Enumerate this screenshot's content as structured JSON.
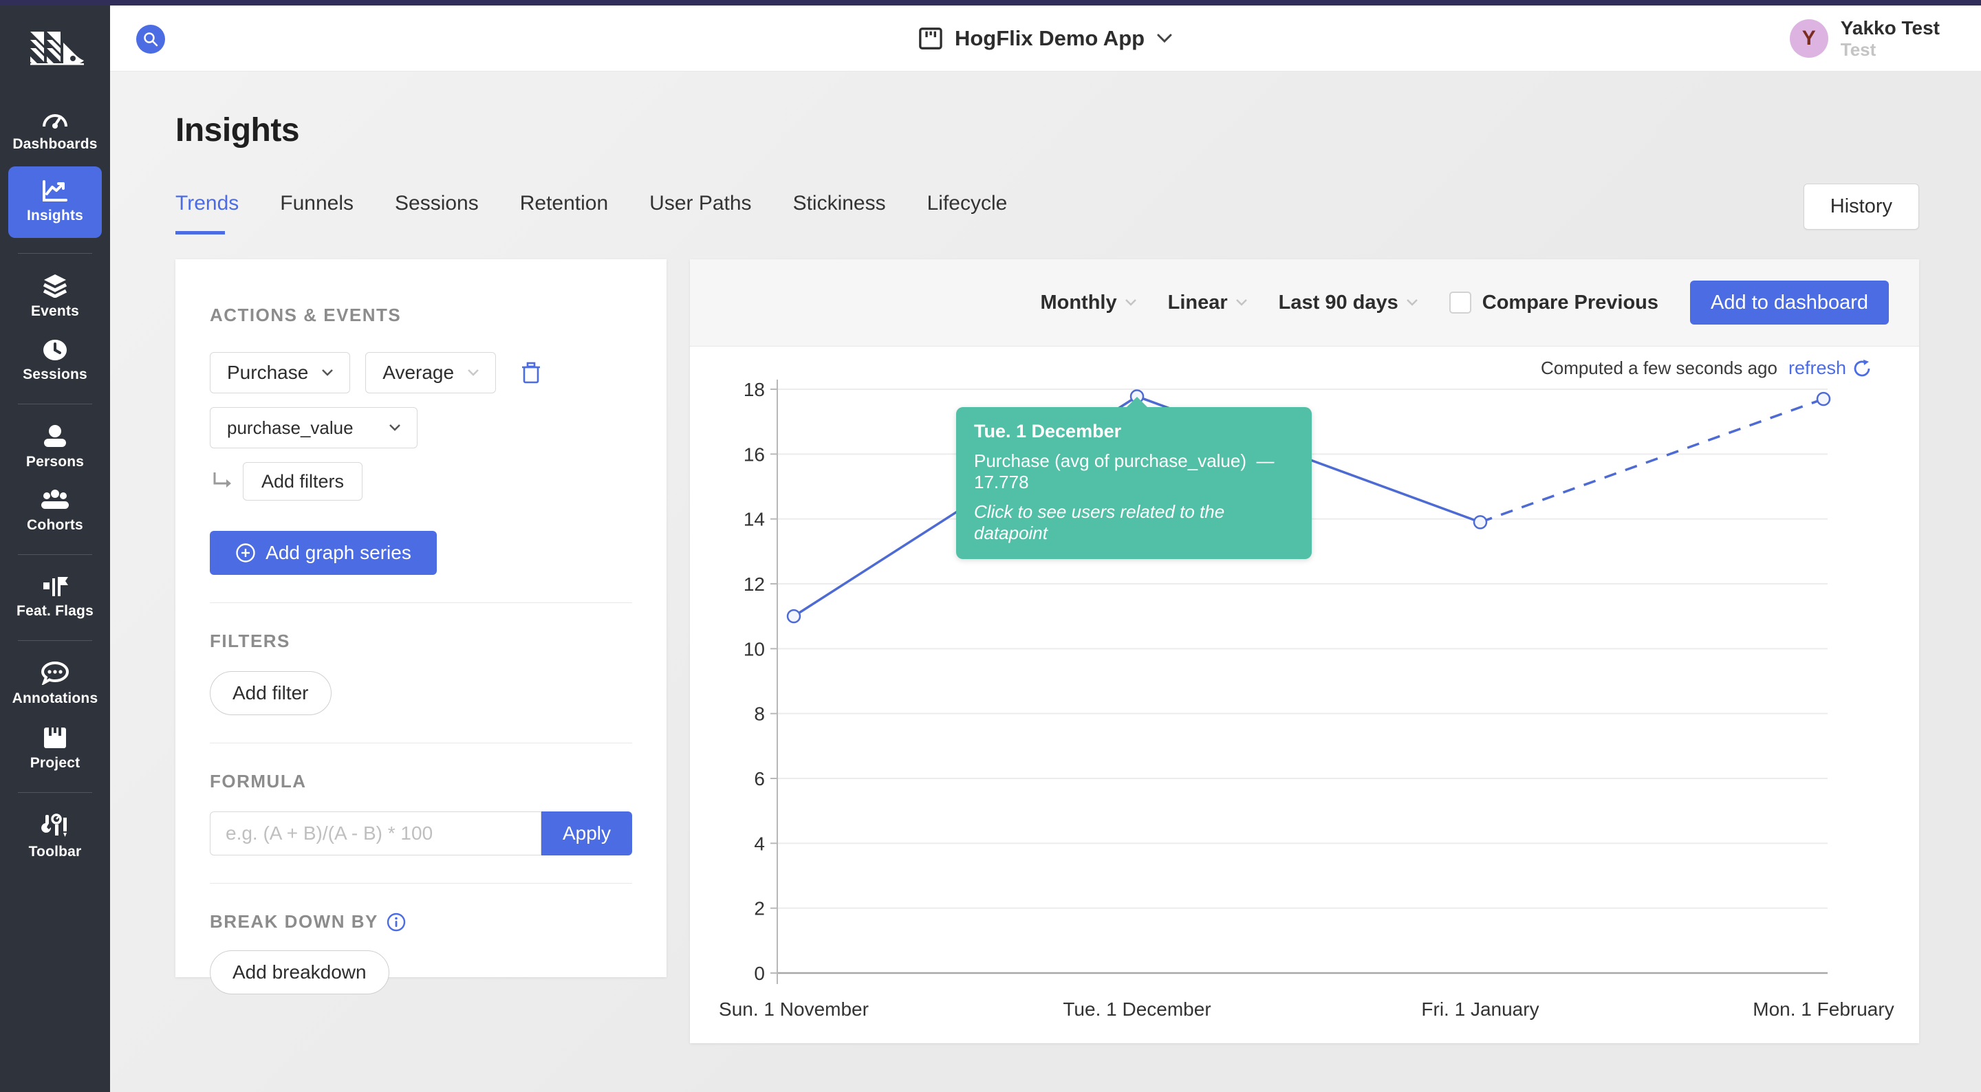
{
  "colors": {
    "primary": "#4b6ce3",
    "teal": "#52bfa7",
    "sidebar_bg": "#2f333b",
    "topstrip": "#322e5a",
    "line": "#4d6bd2",
    "avatar_bg": "#ddb3e2"
  },
  "sidebar": {
    "items": [
      {
        "label": "Dashboards",
        "icon": "dashboards-icon",
        "active": false
      },
      {
        "label": "Insights",
        "icon": "insights-icon",
        "active": true
      },
      {
        "label": "Events",
        "icon": "events-icon",
        "active": false
      },
      {
        "label": "Sessions",
        "icon": "sessions-icon",
        "active": false
      },
      {
        "label": "Persons",
        "icon": "persons-icon",
        "active": false
      },
      {
        "label": "Cohorts",
        "icon": "cohorts-icon",
        "active": false
      },
      {
        "label": "Feat. Flags",
        "icon": "flag-icon",
        "active": false
      },
      {
        "label": "Annotations",
        "icon": "annotations-icon",
        "active": false
      },
      {
        "label": "Project",
        "icon": "project-icon",
        "active": false
      },
      {
        "label": "Toolbar",
        "icon": "toolbar-icon",
        "active": false
      }
    ]
  },
  "header": {
    "project_title": "HogFlix Demo App",
    "user": {
      "initial": "Y",
      "name": "Yakko Test",
      "org": "Test"
    }
  },
  "page": {
    "title": "Insights",
    "tabs": [
      {
        "label": "Trends",
        "active": true
      },
      {
        "label": "Funnels",
        "active": false
      },
      {
        "label": "Sessions",
        "active": false
      },
      {
        "label": "Retention",
        "active": false
      },
      {
        "label": "User Paths",
        "active": false
      },
      {
        "label": "Stickiness",
        "active": false
      },
      {
        "label": "Lifecycle",
        "active": false
      }
    ],
    "history_label": "History"
  },
  "panel": {
    "actions_events": {
      "label": "ACTIONS & EVENTS",
      "event": "Purchase",
      "math": "Average",
      "property": "purchase_value",
      "add_filters_label": "Add filters",
      "add_series_label": "Add graph series"
    },
    "filters": {
      "label": "FILTERS",
      "add_filter_label": "Add filter"
    },
    "formula": {
      "label": "FORMULA",
      "placeholder": "e.g. (A + B)/(A - B) * 100",
      "apply_label": "Apply"
    },
    "breakdown": {
      "label": "BREAK DOWN BY",
      "add_breakdown_label": "Add breakdown"
    }
  },
  "chart": {
    "controls": {
      "interval": "Monthly",
      "display": "Linear",
      "range": "Last 90 days",
      "compare_label": "Compare Previous",
      "add_to_dashboard_label": "Add to dashboard"
    },
    "computed_label": "Computed a few seconds ago",
    "refresh_label": "refresh",
    "tooltip": {
      "date": "Tue. 1 December",
      "series": "Purchase (avg of purchase_value)",
      "separator": "—",
      "value": "17.778",
      "hint": "Click to see users related to the datapoint"
    },
    "chart_data": {
      "type": "line",
      "title": "",
      "x_labels": [
        "Sun. 1 November",
        "Tue. 1 December",
        "Fri. 1 January",
        "Mon. 1 February"
      ],
      "series": [
        {
          "name": "Purchase (avg of purchase_value)",
          "values": [
            11,
            17.778,
            13.9,
            17.7
          ],
          "dashed_from_index": 2
        }
      ],
      "ylim": [
        0,
        18
      ],
      "ytick_step": 2,
      "grid": "horizontal",
      "legend": "none",
      "line_color": "#4d6bd2",
      "highlight_index": 1
    }
  }
}
